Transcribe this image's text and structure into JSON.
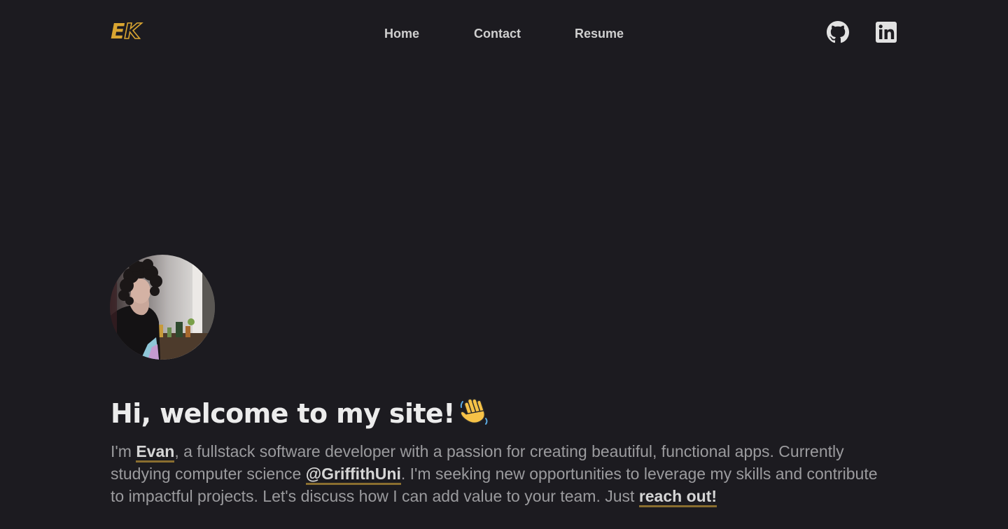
{
  "logo": {
    "letter1": "E",
    "letter2": "K"
  },
  "nav": {
    "links": [
      "Home",
      "Contact",
      "Resume"
    ]
  },
  "social": {
    "github_icon": "github-icon",
    "linkedin_icon": "linkedin-icon"
  },
  "hero": {
    "avatar_alt": "profile-photo",
    "headline": "Hi, welcome to my site!",
    "headline_emoji": "waving-hand",
    "intro": {
      "t1": "I'm ",
      "name_link": "Evan",
      "t2": ", a fullstack software developer with a passion for creating beautiful, functional apps. Currently studying computer science ",
      "uni_link": "@GriffithUni",
      "t3": ". I'm seeking new opportunities to leverage my skills and contribute to impactful projects. Let's discuss how I can add value to your team. Just ",
      "contact_link": "reach out!"
    }
  },
  "colors": {
    "background": "#1c1b20",
    "accent": "#d9a531",
    "link_underline": "#8a6e2f",
    "body_text": "#9b9b9e",
    "heading_text": "#ececec"
  }
}
